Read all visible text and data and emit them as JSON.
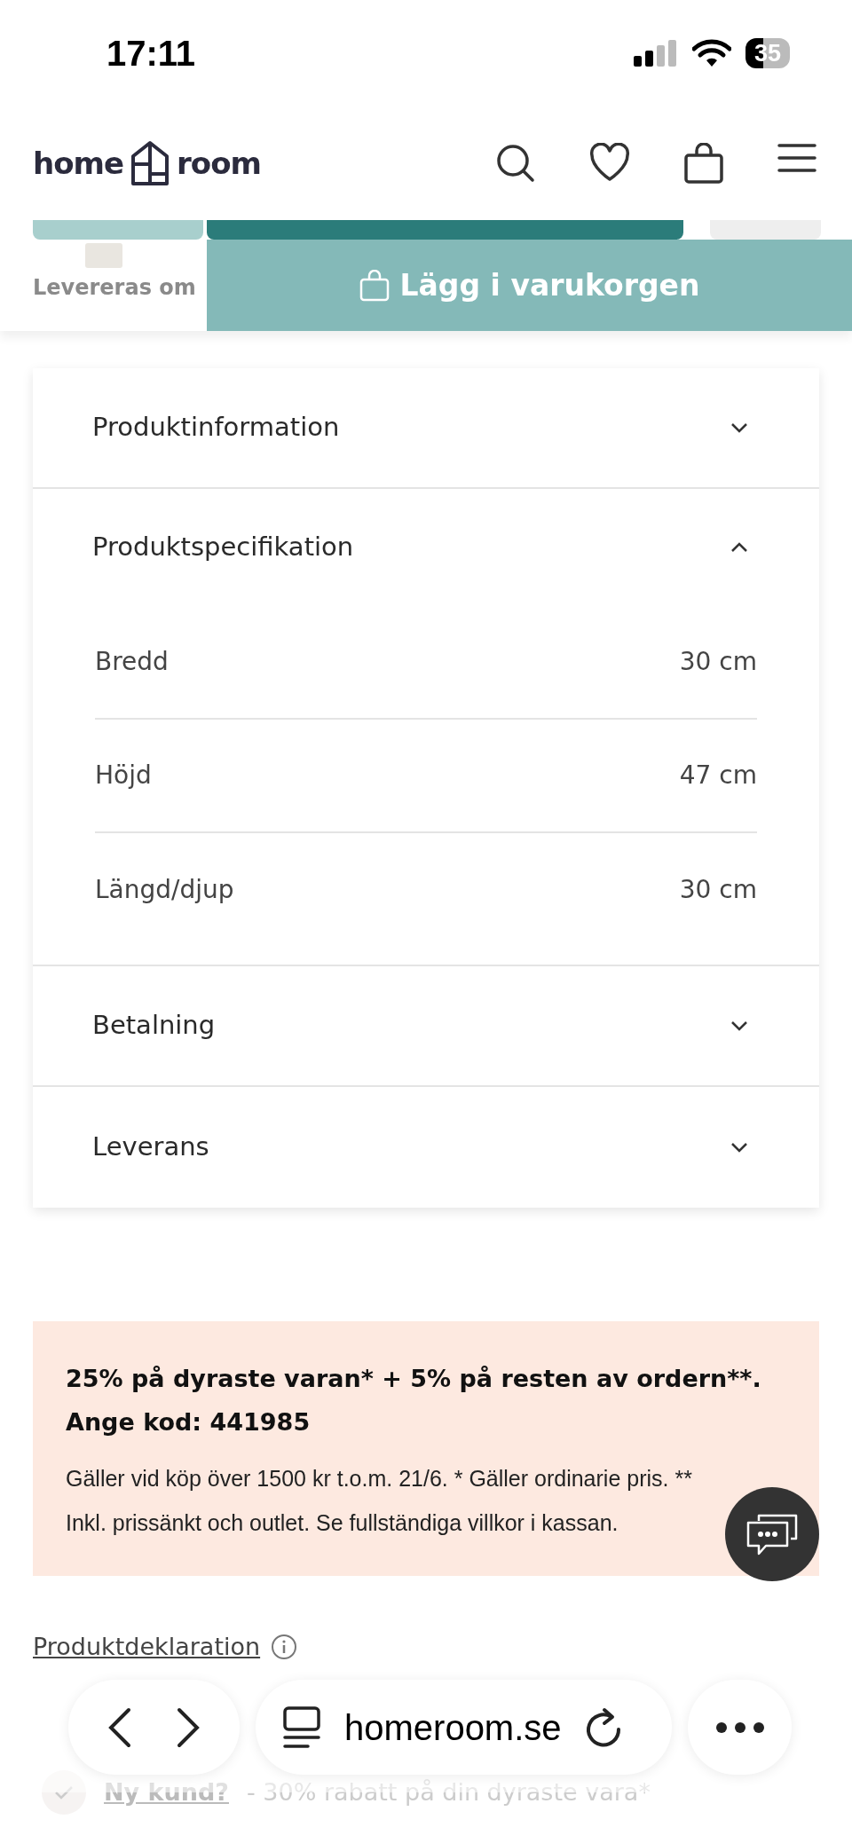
{
  "status_bar": {
    "time": "17:11",
    "battery": "35"
  },
  "header": {
    "logo_left": "home",
    "logo_right": "room"
  },
  "sticky_bar": {
    "delivery_text": "Levereras om",
    "button": "Lägg i varukorgen"
  },
  "accordion": [
    {
      "title": "Produktinformation",
      "expanded": false
    },
    {
      "title": "Produktspecifikation",
      "expanded": true,
      "specs": [
        {
          "label": "Bredd",
          "value": "30 cm"
        },
        {
          "label": "Höjd",
          "value": "47 cm"
        },
        {
          "label": "Längd/djup",
          "value": "30 cm"
        }
      ]
    },
    {
      "title": "Betalning",
      "expanded": false
    },
    {
      "title": "Leverans",
      "expanded": false
    }
  ],
  "promo": {
    "headline": "25% på dyraste varan* + 5% på resten av ordern**. Ange kod: 441985",
    "body": "Gäller vid köp över 1500 kr t.o.m. 21/6. * Gäller ordinarie pris. ** Inkl. prissänkt och outlet. Se fullständiga villkor i kassan."
  },
  "declaration_link": "Produktdeklaration",
  "browser_bar": {
    "url": "homeroom.se"
  },
  "footer_note": {
    "link": "Ny kund?",
    "text": "- 30% rabatt på din dyraste vara*"
  }
}
